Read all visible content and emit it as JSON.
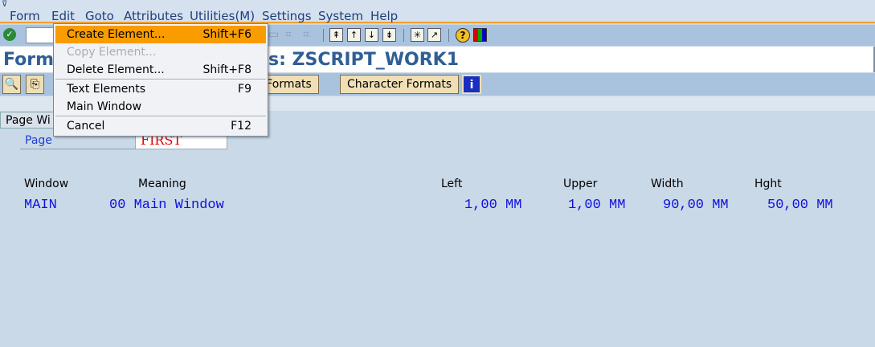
{
  "menubar": {
    "items": [
      "Form",
      "Edit",
      "Goto",
      "Attributes",
      "Utilities(M)",
      "Settings",
      "System",
      "Help"
    ]
  },
  "title": {
    "left": "Form:",
    "right": "s: ZSCRIPT_WORK1"
  },
  "app_toolbar": {
    "paragraph_formats_visible": "ph Formats",
    "character_formats": "Character Formats",
    "info": "i"
  },
  "tab": {
    "label": "Page Wi"
  },
  "page": {
    "label": "Page",
    "value": "FIRST"
  },
  "table": {
    "headers": [
      "Window",
      "Meaning",
      "Left",
      "Upper",
      "Width",
      "Hght"
    ],
    "rows": [
      {
        "window": "MAIN",
        "meaning": "00 Main Window",
        "left": "1,00 MM",
        "upper": "1,00 MM",
        "width": "90,00 MM",
        "hght": "50,00 MM"
      }
    ]
  },
  "edit_menu": {
    "items": [
      {
        "label": "Create Element...",
        "shortcut": "Shift+F6",
        "state": "highlighted"
      },
      {
        "label": "Copy Element...",
        "shortcut": "",
        "state": "disabled"
      },
      {
        "label": "Delete Element...",
        "shortcut": "Shift+F8",
        "state": "normal"
      },
      {
        "label": "Text Elements",
        "shortcut": "F9",
        "state": "normal"
      },
      {
        "label": "Main Window",
        "shortcut": "",
        "state": "normal"
      },
      {
        "label": "Cancel",
        "shortcut": "F12",
        "state": "normal"
      }
    ]
  }
}
